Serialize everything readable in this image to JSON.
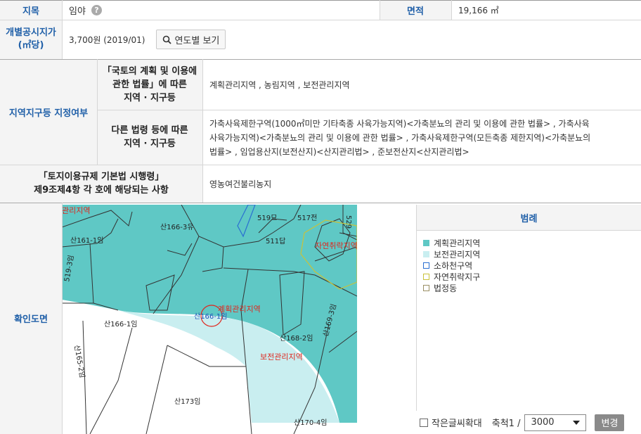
{
  "row1": {
    "label": "지목",
    "value": "임야",
    "area_label": "면적",
    "area_value": "19,166 ㎡"
  },
  "row2": {
    "label_line1": "개별공시지가",
    "label_line2": "(㎡당)",
    "value": "3,700원 (2019/01)",
    "button": "연도별 보기"
  },
  "zone": {
    "label": "지역지구등 지정여부",
    "sub1_lines": [
      "「국토의 계획 및 이용에",
      "관한 법률」에 따른",
      "지역 · 지구등"
    ],
    "sub1_value": "계획관리지역 , 농림지역 , 보전관리지역",
    "sub2_lines": [
      "다른 법령 등에 따른",
      "지역 · 지구등"
    ],
    "sub2_value_lines": [
      "가축사육제한구역(1000㎡미만 기타축종 사육가능지역)<가축분뇨의 관리 및 이용에 관한 법률> , 가축사육",
      "사육가능지역)<가축분뇨의 관리 및 이용에 관한 법률> , 가축사육제한구역(모든축종 제한지역)<가축분뇨의",
      "법률> , 임업용산지(보전산지)<산지관리법> , 준보전산지<산지관리법>"
    ]
  },
  "land_reg": {
    "label_lines": [
      "「토지이용규제 기본법 시행령」",
      "제9조제4항 각 호에 해당되는 사항"
    ],
    "value": "영농여건불리농지"
  },
  "map_section": {
    "label": "확인도면",
    "map_labels": {
      "p1": "산161-1임",
      "p2": "산166-3유",
      "p3": "519묘",
      "p4": "517전",
      "p5": "511답",
      "p6": "산166-1임",
      "p7": "산168-2임",
      "p8": "산165-2임",
      "p9": "산173임",
      "p10": "산170-4임",
      "p11": "산166-1임",
      "p12": "산169-3임",
      "p13": "519-3임",
      "p14": "529",
      "z1": "계획관리지역",
      "z2": "보전관리지역",
      "z3": "자연취락지역",
      "z4": "관리지역"
    },
    "legend_title": "범례",
    "legend": [
      {
        "label": "계획관리지역",
        "color": "#5fc8c5",
        "style": "fill"
      },
      {
        "label": "보전관리지역",
        "color": "#c9eef0",
        "style": "fill"
      },
      {
        "label": "소하천구역",
        "color": "#2a6fd1",
        "style": "outline"
      },
      {
        "label": "자연취락지구",
        "color": "#c9c23a",
        "style": "outline"
      },
      {
        "label": "법정동",
        "color": "#9a8f64",
        "style": "outline"
      }
    ],
    "small_text_label": "작은글씨확대",
    "scale_label": "축척1 /",
    "scale_value": "3000",
    "change_button": "변경"
  }
}
